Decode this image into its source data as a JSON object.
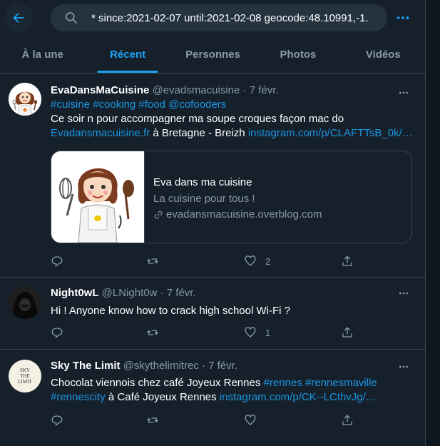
{
  "search": {
    "query": "* since:2021-02-07 until:2021-02-08 geocode:48.10991,-1."
  },
  "tabs": [
    {
      "label": "À la une",
      "active": false
    },
    {
      "label": "Récent",
      "active": true
    },
    {
      "label": "Personnes",
      "active": false
    },
    {
      "label": "Photos",
      "active": false
    },
    {
      "label": "Vidéos",
      "active": false
    }
  ],
  "colors": {
    "background": "#15202b",
    "accent": "#1da1f2",
    "link": "#1b95e0",
    "muted": "#8899a6",
    "border": "#38444d"
  },
  "tweets": [
    {
      "name": "EvaDansMaCuisine",
      "handle": "@evadsmacuisine",
      "sep": "·",
      "date": "7 févr.",
      "hashtags": "#cuisine #cooking #food @cofooders",
      "text": "Ce soir n pour accompagner ma soupe croques façon mac do",
      "link1": "Evadansmacuisine.fr",
      "text2": " à Bretagne - Breizh ",
      "link2": "instagram.com/p/CLAFTTsB_0k/…",
      "card": {
        "title": "Eva dans ma cuisine",
        "description": "La cuisine pour tous !",
        "domain": "evadansmacuisine.overblog.com"
      },
      "replies": "",
      "retweets": "",
      "likes": "2"
    },
    {
      "name": "Night0wL",
      "handle": "@LNight0w",
      "sep": "·",
      "date": "7 févr.",
      "text": "Hi ! Anyone know how to crack high school Wi-Fi ?",
      "replies": "",
      "retweets": "",
      "likes": "1"
    },
    {
      "name": "Sky The Limit",
      "handle": "@skythelimitrec",
      "sep": "·",
      "date": "7 févr.",
      "text": "Chocolat viennois chez café Joyeux Rennes ",
      "hashtags1": "#rennes #rennesmaville",
      "hashtags2": "#rennescity",
      "text2": " à Café Joyeux Rennes ",
      "link": "instagram.com/p/CK--LCthvJg/…",
      "avatar_text": [
        "SKY",
        "THE",
        "LIMIT"
      ],
      "replies": "",
      "retweets": "",
      "likes": ""
    }
  ]
}
